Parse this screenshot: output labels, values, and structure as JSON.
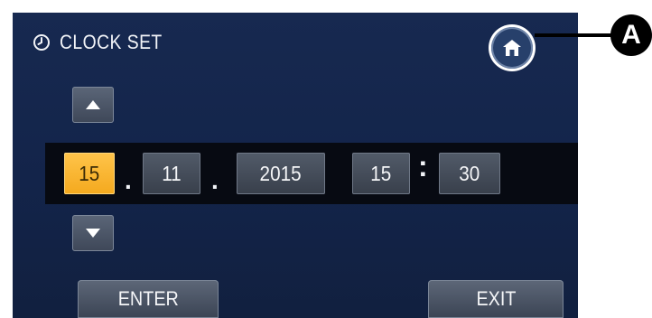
{
  "header": {
    "icon": "clock-icon",
    "title": "CLOCK SET"
  },
  "home_button": {
    "icon": "home-icon"
  },
  "controls": {
    "up_icon": "triangle-up-icon",
    "down_icon": "triangle-down-icon"
  },
  "datetime": {
    "day": "15",
    "month": "11",
    "year": "2015",
    "hour": "15",
    "minute": "30",
    "date_separator": ".",
    "time_separator": ":",
    "selected_field": "day"
  },
  "footer": {
    "enter_label": "ENTER",
    "exit_label": "EXIT"
  },
  "callout": {
    "label": "A"
  },
  "colors": {
    "screen_background": "#172950",
    "selected_field": "#ffc44a",
    "field": "#525b69",
    "strip": "#070a12"
  }
}
